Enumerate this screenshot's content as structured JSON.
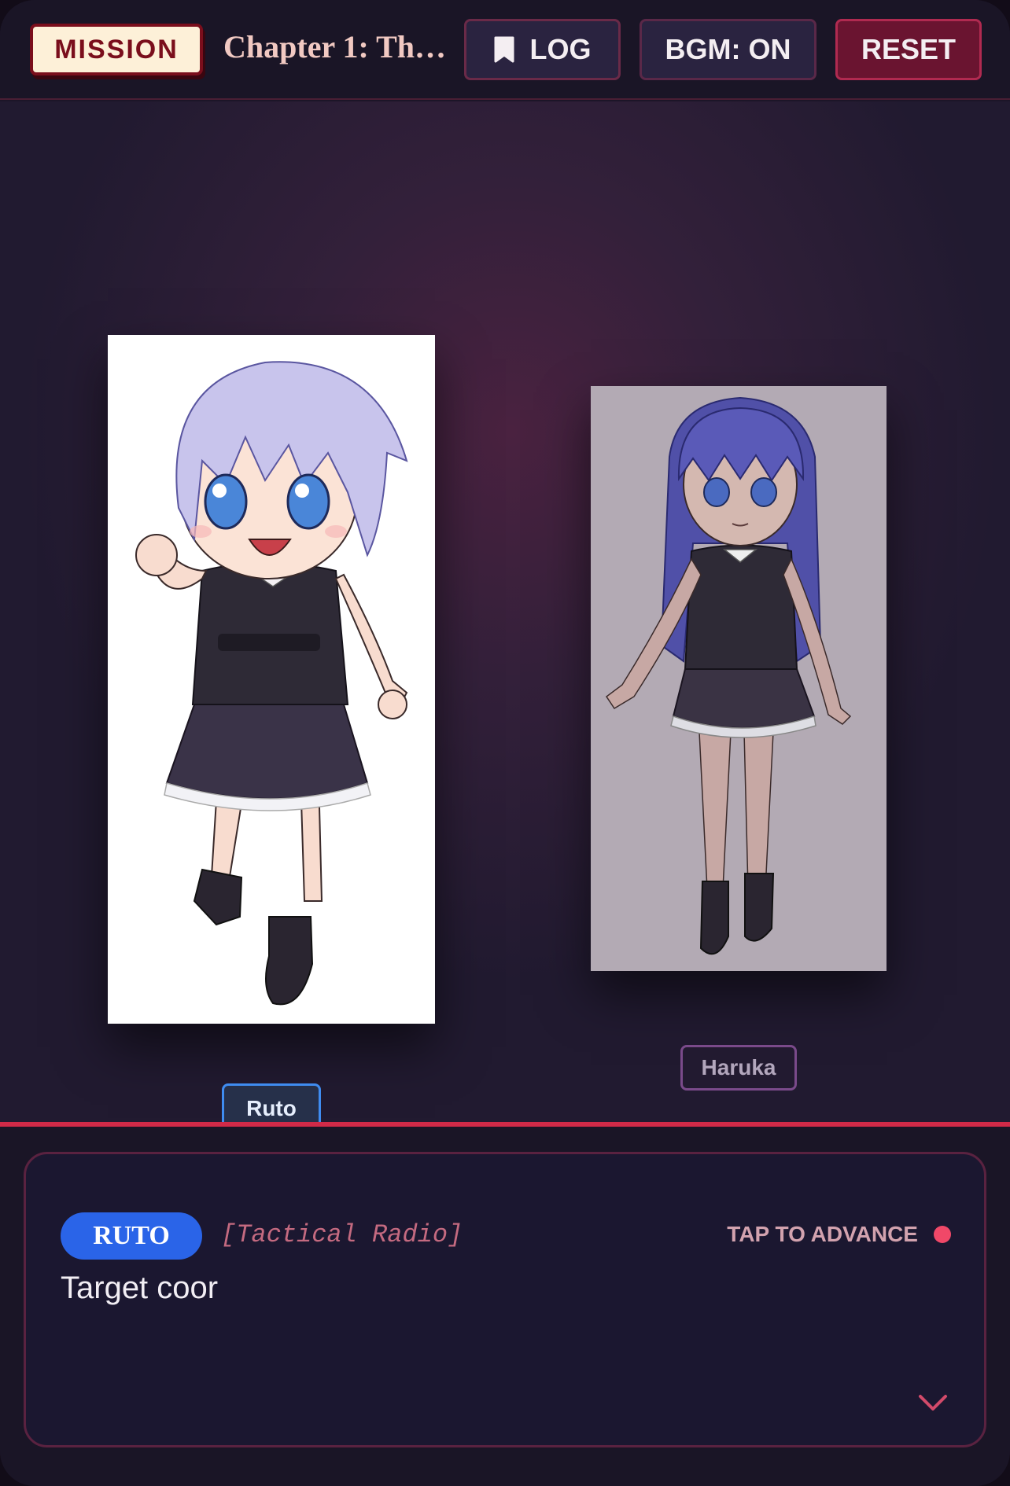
{
  "header": {
    "mission_label": "MISSION",
    "chapter_title": "Chapter 1: Th…",
    "log_label": "LOG",
    "bgm_label": "BGM: ON",
    "reset_label": "RESET"
  },
  "stage": {
    "characters": [
      {
        "id": "ruto",
        "name": "Ruto",
        "tag_color": "#3f8cf0",
        "active": true
      },
      {
        "id": "haruka",
        "name": "Haruka",
        "tag_color": "#7a4a8a",
        "active": false
      }
    ]
  },
  "dialogue": {
    "speaker": "RUTO",
    "channel": "[Tactical Radio]",
    "advance_label": "TAP TO ADVANCE",
    "text": "Target coor",
    "speaker_color": "#2a64e8",
    "accent_color": "#f04868"
  },
  "icons": {
    "log": "bookmark-icon",
    "advance": "chevron-down-icon",
    "indicator": "record-dot-icon"
  }
}
